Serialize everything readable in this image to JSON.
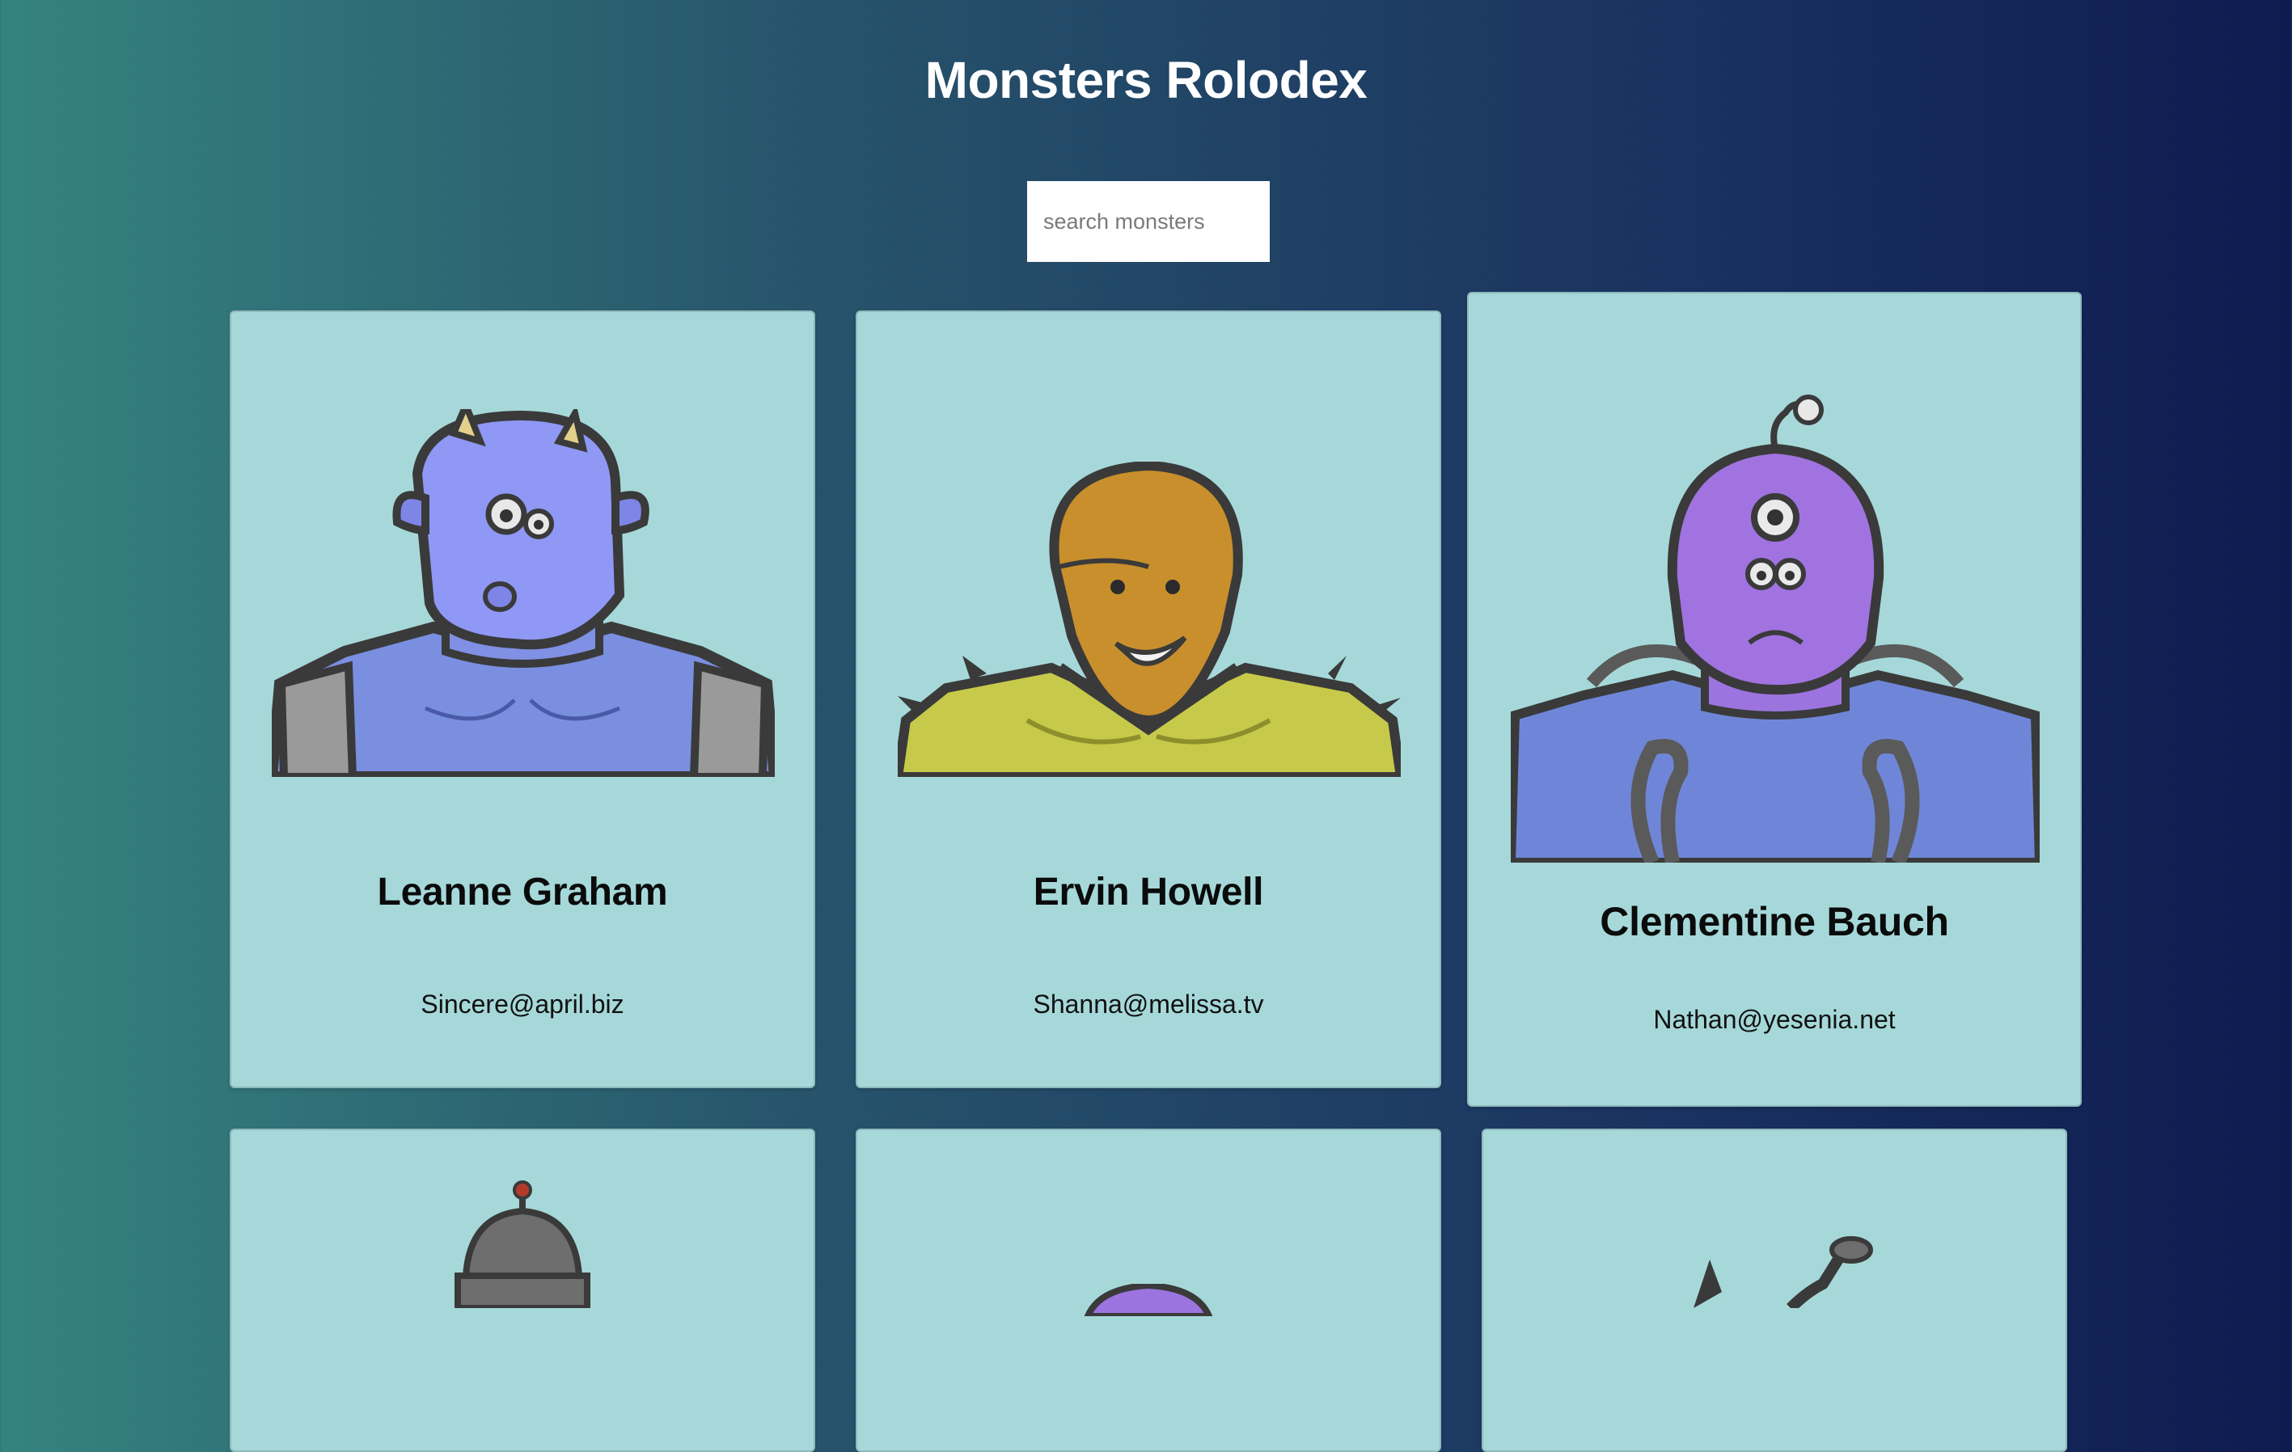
{
  "app": {
    "title": "Monsters Rolodex"
  },
  "search": {
    "placeholder": "search monsters",
    "value": ""
  },
  "monsters": [
    {
      "name": "Leanne Graham",
      "email": "Sincere@april.biz",
      "avatar": "blue-horned-monster"
    },
    {
      "name": "Ervin Howell",
      "email": "Shanna@melissa.tv",
      "avatar": "yellow-spiked-monster"
    },
    {
      "name": "Clementine Bauch",
      "email": "Nathan@yesenia.net",
      "avatar": "purple-three-eyed-robot-monster"
    },
    {
      "name": "",
      "email": "",
      "avatar": "grey-robot-monster"
    },
    {
      "name": "",
      "email": "",
      "avatar": "purple-monster"
    },
    {
      "name": "",
      "email": "",
      "avatar": "antenna-monster"
    }
  ],
  "colors": {
    "card_background": "#a6d8d9",
    "gradient_start": "#35837f",
    "gradient_end": "#0e1b50"
  }
}
